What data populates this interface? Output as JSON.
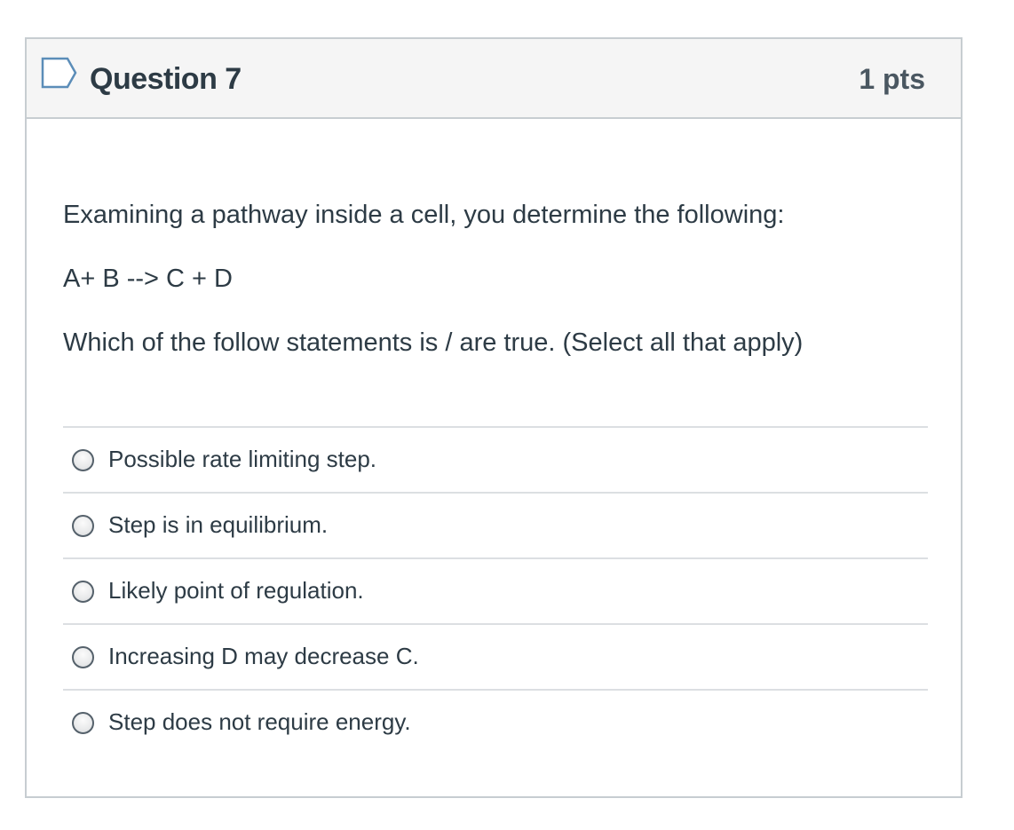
{
  "question": {
    "title": "Question 7",
    "points": "1 pts",
    "flag_icon": "flag-outline-icon",
    "prompt_lines": [
      "Examining a pathway inside a cell, you determine the following:",
      "A+ B --> C + D",
      "Which of the follow statements is / are true. (Select all that apply)"
    ],
    "answers": [
      {
        "label": "Possible rate limiting step.",
        "checked": false
      },
      {
        "label": "Step is in equilibrium.",
        "checked": false
      },
      {
        "label": "Likely point of regulation.",
        "checked": false
      },
      {
        "label": "Increasing D may decrease C.",
        "checked": false
      },
      {
        "label": "Step does not require energy.",
        "checked": false
      }
    ]
  },
  "colors": {
    "header_bg": "#f5f5f5",
    "border": "#c7cdd1",
    "text": "#2d3b45",
    "flag": "#5b8db8"
  }
}
